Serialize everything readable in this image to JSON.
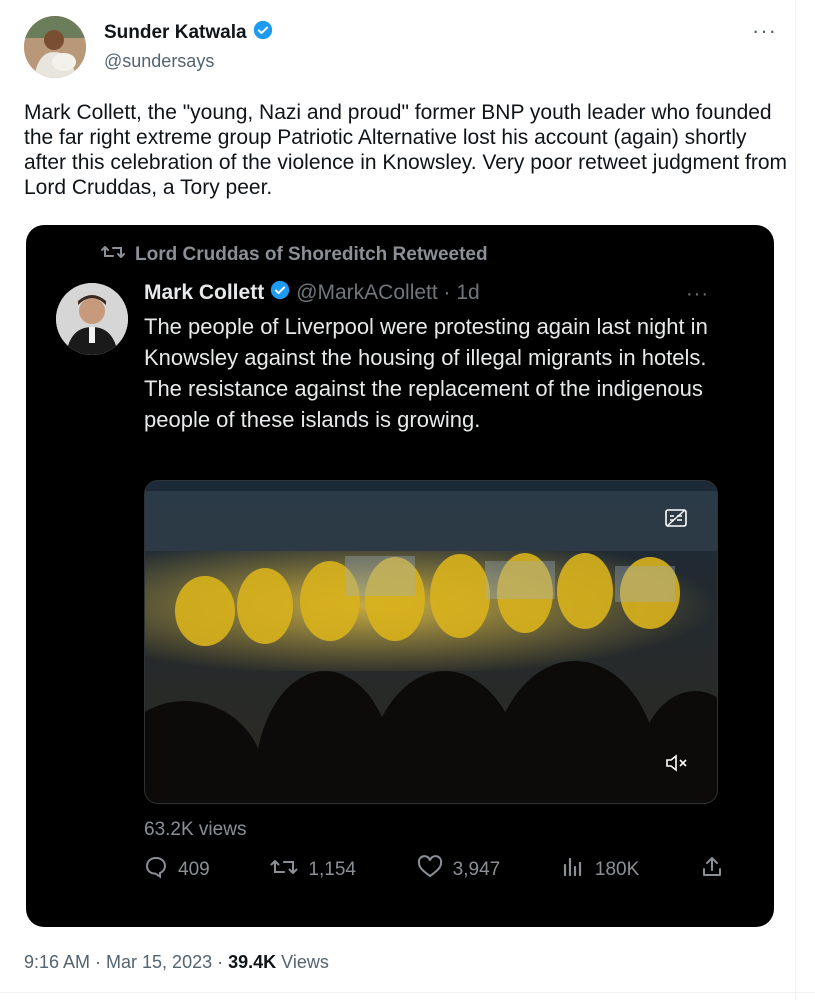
{
  "author": {
    "name": "Sunder Katwala",
    "handle": "@sundersays",
    "verified": true
  },
  "tweet_text": "Mark Collett, the \"young, Nazi and proud\" former BNP youth leader who founded the far right extreme group Patriotic Alternative lost his account (again) shortly after this celebration of the violence in Knowsley.  Very poor retweet judgment from Lord Cruddas, a Tory peer.",
  "screenshot": {
    "retweeted_by": "Lord Cruddas of Shoreditch Retweeted",
    "name": "Mark Collett",
    "handle_time": "@MarkACollett · 1d",
    "text": "The people of Liverpool were protesting again last night in Knowsley against the housing of illegal migrants in hotels.\nThe resistance against the replacement of the indigenous people of these islands is growing.",
    "views": "63.2K views",
    "replies": "409",
    "retweets": "1,154",
    "likes": "3,947",
    "analytics": "180K"
  },
  "footer": {
    "time_date": "9:16 AM · Mar 15, 2023 · ",
    "views_count": "39.4K",
    "views_label": " Views"
  },
  "colors": {
    "verified": "#1d9bf0",
    "text": "#0f1419",
    "secondary": "#536471"
  },
  "icons": [
    "more-icon",
    "verified-icon",
    "retweet-icon",
    "reply-icon",
    "like-icon",
    "analytics-icon",
    "share-icon",
    "captions-icon",
    "mute-icon"
  ]
}
